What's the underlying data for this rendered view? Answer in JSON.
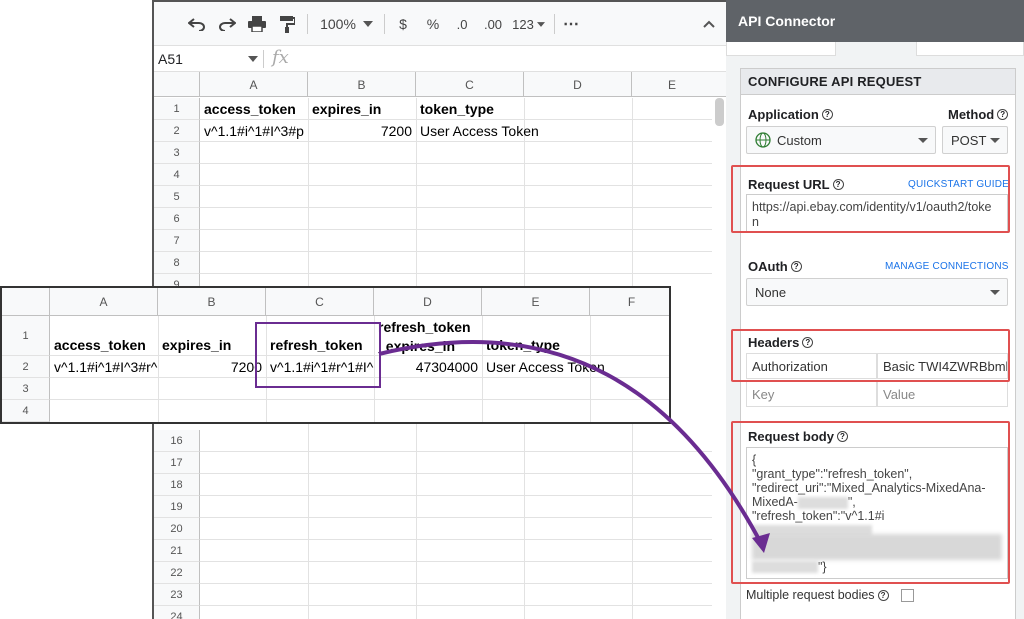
{
  "toolbar": {
    "zoom": "100%",
    "currency": "$",
    "percent": "%",
    "dec_less": ".0",
    "dec_more": ".00",
    "format_more": "123",
    "more": "⋯"
  },
  "formula_bar": {
    "cell_ref": "A51",
    "fx": "fx"
  },
  "sheet": {
    "columns": [
      "A",
      "B",
      "C",
      "D",
      "E"
    ],
    "rows_top": [
      "1",
      "2",
      "3",
      "4",
      "5",
      "6",
      "7",
      "8",
      "9"
    ],
    "rows_bottom": [
      "16",
      "17",
      "18",
      "19",
      "20",
      "21",
      "22",
      "23",
      "24"
    ],
    "headers": [
      "access_token",
      "expires_in",
      "token_type"
    ],
    "values": [
      "v^1.1#i^1#I^3#p",
      "7200",
      "User Access Token"
    ]
  },
  "overlay_sheet": {
    "columns": [
      "A",
      "B",
      "C",
      "D",
      "E",
      "F"
    ],
    "rows": [
      "1",
      "2",
      "3",
      "4"
    ],
    "headers": [
      "access_token",
      "expires_in",
      "refresh_token",
      "refresh_token",
      "_expires_in",
      "token_type"
    ],
    "values": [
      "v^1.1#i^1#I^3#r^",
      "7200",
      "v^1.1#i^1#r^1#I^",
      "47304000",
      "User Access Token"
    ]
  },
  "panel": {
    "title": "API Connector",
    "card_title": "CONFIGURE API REQUEST",
    "application_label": "Application",
    "application_value": "Custom",
    "method_label": "Method",
    "method_value": "POST",
    "request_url_label": "Request URL",
    "quickstart_link": "QUICKSTART GUIDE",
    "request_url_line1": "https://api.ebay.com/identity/v1/oauth2/toke",
    "request_url_line2": "n",
    "oauth_label": "OAuth",
    "manage_link": "MANAGE CONNECTIONS",
    "oauth_value": "None",
    "headers_label": "Headers",
    "header_key": "Authorization",
    "header_value": "Basic TWI4ZWRBbml",
    "key_placeholder": "Key",
    "value_placeholder": "Value",
    "body_label": "Request body",
    "body_lines": [
      "{",
      "\"grant_type\":\"refresh_token\",",
      "\"redirect_uri\":\"Mixed_Analytics-MixedAna-",
      "MixedA-",
      "\",",
      "\"refresh_token\":\"v^1.1#i",
      "\"}"
    ],
    "multiple_label": "Multiple request bodies",
    "help": "?"
  },
  "colors": {
    "highlight_red": "#e05050",
    "highlight_purple": "#6a2c91",
    "accent_blue": "#1a73e8"
  }
}
